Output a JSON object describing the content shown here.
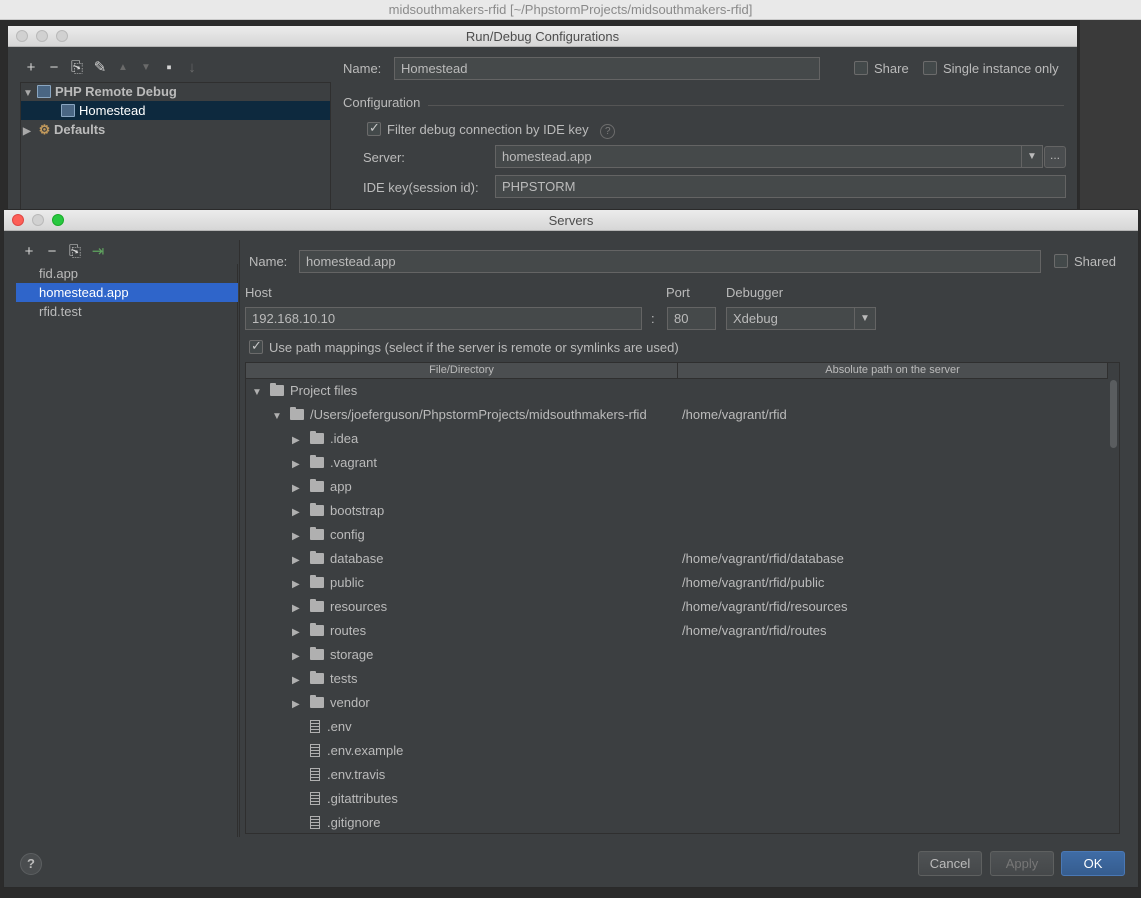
{
  "main_title": "midsouthmakers-rfid [~/PhpstormProjects/midsouthmakers-rfid]",
  "run_debug": {
    "title": "Run/Debug Configurations",
    "toolbar": {
      "add": "+",
      "remove": "−",
      "copy": "⎘",
      "wrench": "✎",
      "up": "▲",
      "down": "▼",
      "folder": "▪",
      "sort": "↓"
    },
    "tree": [
      {
        "label": "PHP Remote Debug",
        "bold": true,
        "expanded": true
      },
      {
        "label": "Homestead",
        "selected": true
      },
      {
        "label": "Defaults",
        "bold": true,
        "expanded": false
      }
    ],
    "name_label": "Name:",
    "name_value": "Homestead",
    "share_label": "Share",
    "single_instance_label": "Single instance only",
    "configuration_label": "Configuration",
    "filter_label": "Filter debug connection by IDE key",
    "help_glyph": "?",
    "server_label": "Server:",
    "server_value": "homestead.app",
    "ide_key_label": "IDE key(session id):",
    "ide_key_value": "PHPSTORM",
    "combo_arrow": "▼",
    "dots": "..."
  },
  "servers": {
    "title": "Servers",
    "toolbar": {
      "add": "+",
      "remove": "−",
      "copy": "⎘",
      "import": "⇥"
    },
    "list": [
      "fid.app",
      "homestead.app",
      "rfid.test"
    ],
    "selected_index": 1,
    "name_label": "Name:",
    "name_value": "homestead.app",
    "shared_label": "Shared",
    "host_label": "Host",
    "host_value": "192.168.10.10",
    "colon": ":",
    "port_label": "Port",
    "port_value": "80",
    "debugger_label": "Debugger",
    "debugger_value": "Xdebug",
    "use_mappings_label": "Use path mappings (select if the server is remote or symlinks are used)",
    "columns": [
      "File/Directory",
      "Absolute path on the server"
    ],
    "rows": [
      {
        "label": "Project files",
        "indent": 0,
        "kind": "folder",
        "expander": "▼",
        "path": ""
      },
      {
        "label": "/Users/joeferguson/PhpstormProjects/midsouthmakers-rfid",
        "indent": 1,
        "kind": "folder",
        "expander": "▼",
        "path": "/home/vagrant/rfid"
      },
      {
        "label": ".idea",
        "indent": 2,
        "kind": "folder",
        "expander": "▶",
        "path": ""
      },
      {
        "label": ".vagrant",
        "indent": 2,
        "kind": "folder",
        "expander": "▶",
        "path": ""
      },
      {
        "label": "app",
        "indent": 2,
        "kind": "folder",
        "expander": "▶",
        "path": ""
      },
      {
        "label": "bootstrap",
        "indent": 2,
        "kind": "folder",
        "expander": "▶",
        "path": ""
      },
      {
        "label": "config",
        "indent": 2,
        "kind": "folder",
        "expander": "▶",
        "path": ""
      },
      {
        "label": "database",
        "indent": 2,
        "kind": "folder",
        "expander": "▶",
        "path": "/home/vagrant/rfid/database"
      },
      {
        "label": "public",
        "indent": 2,
        "kind": "folder",
        "expander": "▶",
        "path": "/home/vagrant/rfid/public"
      },
      {
        "label": "resources",
        "indent": 2,
        "kind": "folder",
        "expander": "▶",
        "path": "/home/vagrant/rfid/resources"
      },
      {
        "label": "routes",
        "indent": 2,
        "kind": "folder",
        "expander": "▶",
        "path": "/home/vagrant/rfid/routes"
      },
      {
        "label": "storage",
        "indent": 2,
        "kind": "folder",
        "expander": "▶",
        "path": ""
      },
      {
        "label": "tests",
        "indent": 2,
        "kind": "folder",
        "expander": "▶",
        "path": ""
      },
      {
        "label": "vendor",
        "indent": 2,
        "kind": "folder",
        "expander": "▶",
        "path": ""
      },
      {
        "label": ".env",
        "indent": 2,
        "kind": "file",
        "expander": "",
        "path": ""
      },
      {
        "label": ".env.example",
        "indent": 2,
        "kind": "file",
        "expander": "",
        "path": ""
      },
      {
        "label": ".env.travis",
        "indent": 2,
        "kind": "file",
        "expander": "",
        "path": ""
      },
      {
        "label": ".gitattributes",
        "indent": 2,
        "kind": "file",
        "expander": "",
        "path": ""
      },
      {
        "label": ".gitignore",
        "indent": 2,
        "kind": "file",
        "expander": "",
        "path": ""
      }
    ],
    "help_glyph": "?",
    "cancel_label": "Cancel",
    "apply_label": "Apply",
    "ok_label": "OK"
  }
}
